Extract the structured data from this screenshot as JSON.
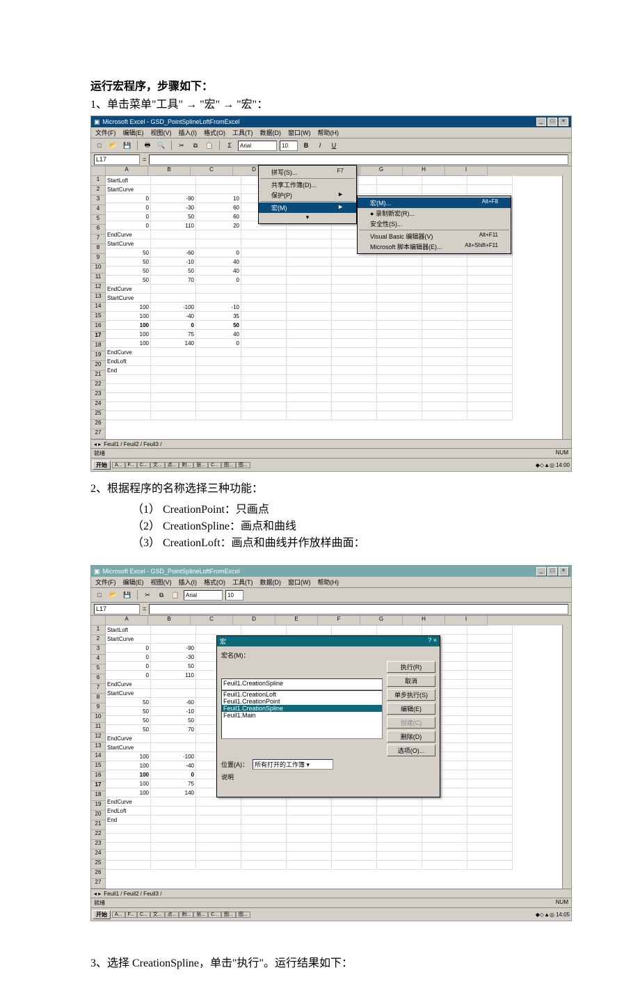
{
  "text": {
    "heading": "运行宏程序，步骤如下：",
    "step1": "1、单击菜单\"工具\" → \"宏\" → \"宏\"：",
    "step2": "2、根据程序的名称选择三种功能：",
    "step2_1": "（1） CreationPoint：只画点",
    "step2_2": "（2） CreationSpline：画点和曲线",
    "step2_3": "（3） CreationLoft：画点和曲线并作放样曲面：",
    "step3": "3、选择 CreationSpline，单击\"执行\"。运行结果如下："
  },
  "app": {
    "title": "Microsoft Excel - GSD_PointSplineLoftFromExcel",
    "menus": [
      "文件(F)",
      "编辑(E)",
      "视图(V)",
      "插入(I)",
      "格式(O)",
      "工具(T)",
      "数据(D)",
      "窗口(W)",
      "帮助(H)"
    ],
    "cellref": "L17",
    "font": "Arial",
    "fontsize": "10",
    "f7_hint": "F7",
    "cols": [
      "A",
      "B",
      "C",
      "D",
      "E",
      "F",
      "G",
      "H",
      "I"
    ],
    "rows": [
      {
        "n": "1",
        "a": "StartLoft",
        "b": "",
        "c": ""
      },
      {
        "n": "2",
        "a": "StartCurve",
        "b": "",
        "c": ""
      },
      {
        "n": "3",
        "a": "0",
        "b": "-90",
        "c": "10"
      },
      {
        "n": "4",
        "a": "0",
        "b": "-30",
        "c": "60"
      },
      {
        "n": "5",
        "a": "0",
        "b": "50",
        "c": "60"
      },
      {
        "n": "6",
        "a": "0",
        "b": "110",
        "c": "20"
      },
      {
        "n": "7",
        "a": "EndCurve",
        "b": "",
        "c": ""
      },
      {
        "n": "8",
        "a": "StartCurve",
        "b": "",
        "c": ""
      },
      {
        "n": "9",
        "a": "50",
        "b": "-60",
        "c": "0"
      },
      {
        "n": "10",
        "a": "50",
        "b": "-10",
        "c": "40"
      },
      {
        "n": "11",
        "a": "50",
        "b": "50",
        "c": "40"
      },
      {
        "n": "12",
        "a": "50",
        "b": "70",
        "c": "0"
      },
      {
        "n": "13",
        "a": "EndCurve",
        "b": "",
        "c": ""
      },
      {
        "n": "14",
        "a": "StartCurve",
        "b": "",
        "c": ""
      },
      {
        "n": "15",
        "a": "100",
        "b": "-100",
        "c": "-10"
      },
      {
        "n": "16",
        "a": "100",
        "b": "-40",
        "c": "35"
      },
      {
        "n": "17",
        "a": "100",
        "b": "0",
        "c": "50"
      },
      {
        "n": "18",
        "a": "100",
        "b": "75",
        "c": "40"
      },
      {
        "n": "19",
        "a": "100",
        "b": "140",
        "c": "0"
      },
      {
        "n": "20",
        "a": "EndCurve",
        "b": "",
        "c": ""
      },
      {
        "n": "21",
        "a": "EndLoft",
        "b": "",
        "c": ""
      },
      {
        "n": "22",
        "a": "End",
        "b": "",
        "c": ""
      },
      {
        "n": "23",
        "a": "",
        "b": "",
        "c": ""
      },
      {
        "n": "24",
        "a": "",
        "b": "",
        "c": ""
      },
      {
        "n": "25",
        "a": "",
        "b": "",
        "c": ""
      },
      {
        "n": "26",
        "a": "",
        "b": "",
        "c": ""
      },
      {
        "n": "27",
        "a": "",
        "b": "",
        "c": ""
      }
    ],
    "sheet_tabs": "Feuil1 / Feuil2 / Feuil3 /",
    "status_ready": "就绪",
    "status_num": "NUM",
    "taskbar_start": "开始",
    "taskbar_items": [
      "A...",
      "F...",
      "C...",
      "文...",
      "点...",
      "附...",
      "张...",
      "C...",
      "图...",
      "图..."
    ],
    "tools_menu": {
      "spell": "拼写(S)...",
      "shared": "共享工作簿(D)...",
      "protect": "保护(P)",
      "macro": "宏(M)",
      "arrow": "►",
      "down": "▾"
    },
    "macro_submenu": {
      "macro": "宏(M)...",
      "macro_key": "Alt+F8",
      "record": "录制新宏(R)...",
      "security": "安全性(S)...",
      "vbe": "Visual Basic 编辑器(V)",
      "vbe_key": "Alt+F11",
      "mse": "Microsoft 脚本编辑器(E)...",
      "mse_key": "Alt+Shift+F11"
    }
  },
  "dialog": {
    "title": "宏",
    "close_x": "? ×",
    "name_label": "宏名(M)：",
    "name_value": "Feuil1.CreationSpline",
    "list": [
      "Feuil1.CreationLoft",
      "Feuil1.CreationPoint",
      "Feuil1.CreationSpline",
      "Feuil1.Main"
    ],
    "selected_index": 2,
    "btn_run": "执行(R)",
    "btn_cancel": "取消",
    "btn_step": "单步执行(S)",
    "btn_edit": "编辑(E)",
    "btn_create": "创建(C)",
    "btn_delete": "删除(D)",
    "btn_options": "选项(O)...",
    "location_label": "位置(A)：",
    "location_value": "所有打开的工作簿",
    "desc_label": "说明"
  },
  "time": {
    "s1": "14:00",
    "s2": "14:05"
  }
}
